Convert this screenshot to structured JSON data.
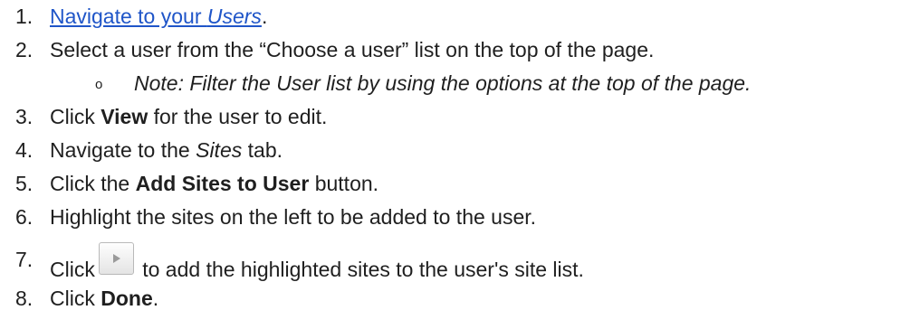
{
  "steps": [
    {
      "n": "1.",
      "link_text": "Navigate to your ",
      "link_italic": "Users",
      "after": "."
    },
    {
      "n": "2.",
      "text": "Select a user from the “Choose a user” list on the top of the page."
    },
    {
      "bullet": "o",
      "note": "Note: Filter the User list by using the options at the top of the page."
    },
    {
      "n": "3.",
      "pre": "Click ",
      "bold": "View",
      "post": " for the user to edit."
    },
    {
      "n": "4.",
      "pre": "Navigate to the ",
      "italic": "Sites",
      "post": " tab."
    },
    {
      "n": "5.",
      "pre": "Click the ",
      "bold": "Add Sites to User",
      "post": " button."
    },
    {
      "n": "6.",
      "text": "Highlight the sites on the left to be added to the user."
    },
    {
      "n": "7.",
      "pre": "Click",
      "icon": "play-arrow-icon",
      "post": " to add the highlighted sites to the user's site list."
    },
    {
      "n": "8.",
      "pre": "Click ",
      "bold": "Done",
      "post": "."
    }
  ]
}
